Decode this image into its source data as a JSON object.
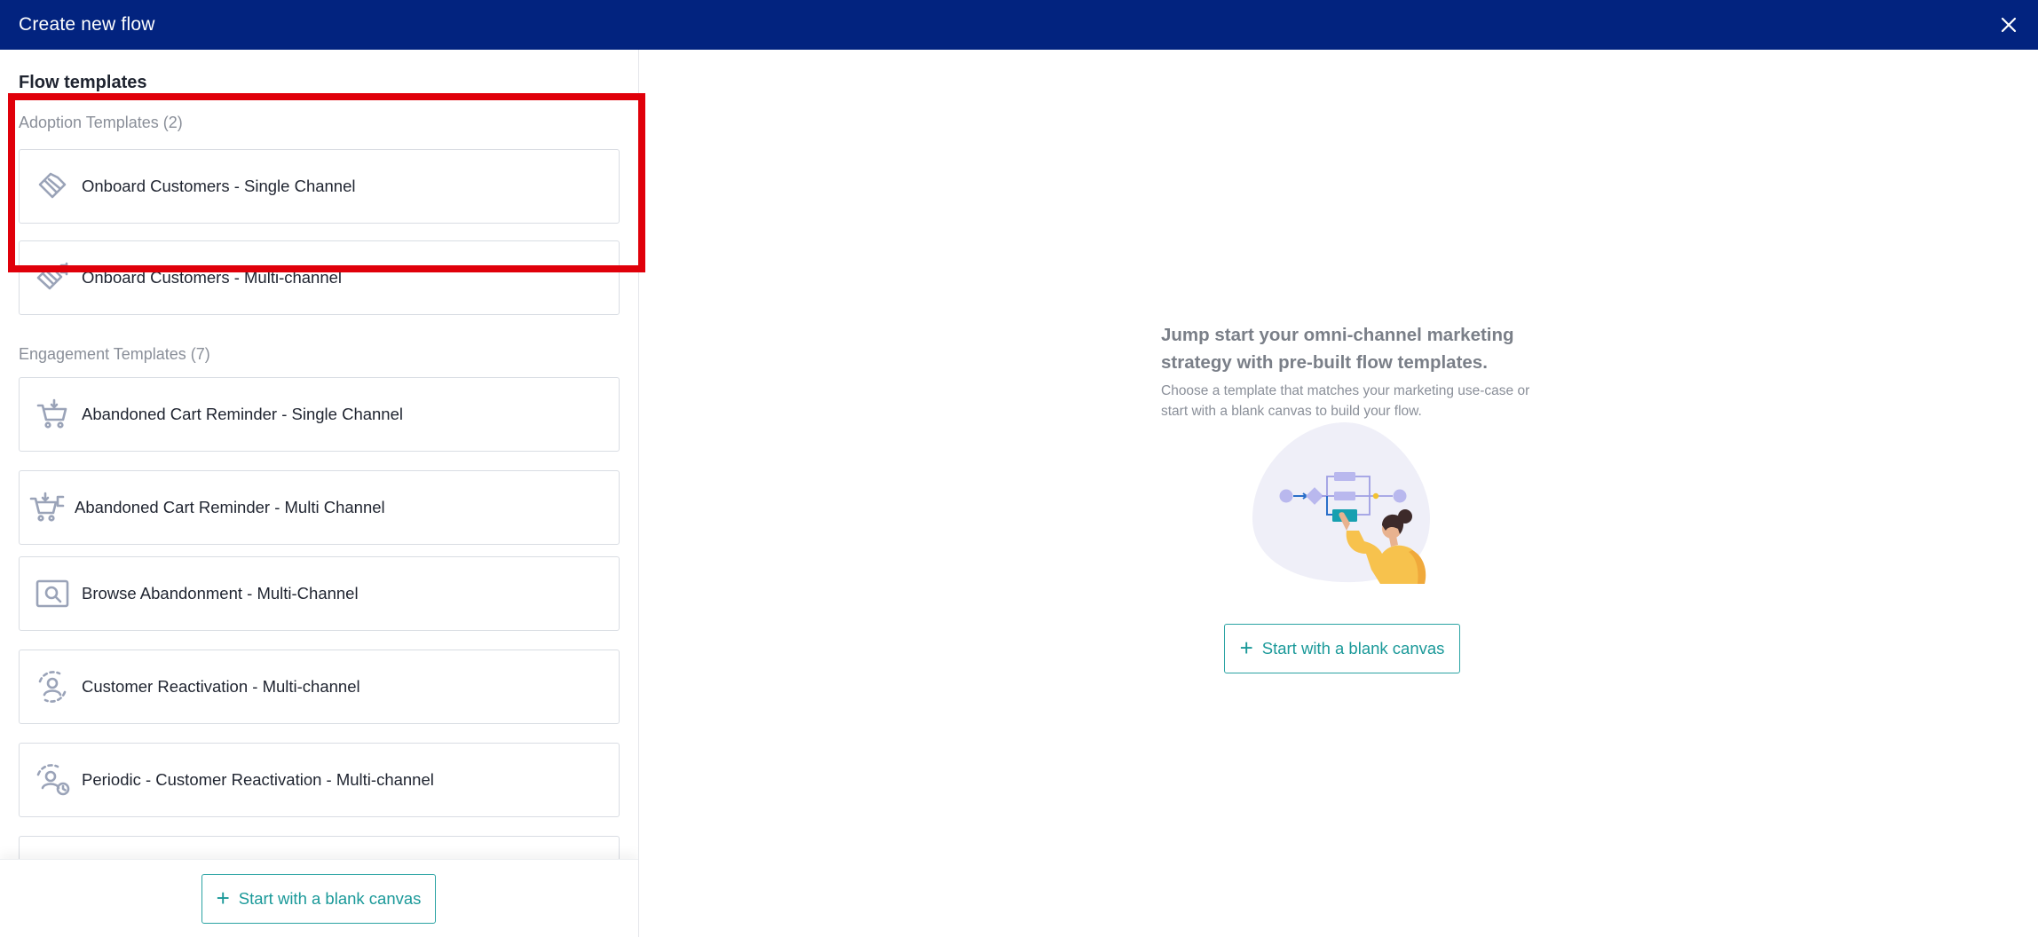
{
  "header": {
    "title": "Create new flow",
    "close_icon": "close-icon"
  },
  "left_panel": {
    "title": "Flow templates",
    "adoption_section": {
      "title": "Adoption Templates (2)",
      "items": [
        {
          "label": "Onboard Customers - Single Channel",
          "icon": "handshake-icon"
        },
        {
          "label": "Onboard Customers - Multi-channel",
          "icon": "handshake-multichannel-icon"
        }
      ]
    },
    "engagement_section": {
      "title": "Engagement Templates (7)",
      "items": [
        {
          "label": "Abandoned Cart Reminder - Single Channel",
          "icon": "cart-icon"
        },
        {
          "label": "Abandoned Cart Reminder - Multi Channel",
          "icon": "cart-multichannel-icon"
        },
        {
          "label": "Browse Abandonment - Multi-Channel",
          "icon": "browse-search-icon"
        },
        {
          "label": "Customer Reactivation - Multi-channel",
          "icon": "user-reactivation-icon"
        },
        {
          "label": "Periodic - Customer Reactivation - Multi-channel",
          "icon": "user-reactivation-clock-icon"
        }
      ]
    },
    "footer": {
      "blank_canvas_label": "Start with a blank canvas"
    }
  },
  "right_panel": {
    "heading": "Jump start your omni-channel marketing strategy with pre-built flow templates.",
    "subtext": "Choose a template that matches your marketing use-case or start with a blank canvas to build your flow.",
    "blank_canvas_label": "Start with a blank canvas",
    "illustration": "flow-builder-illustration"
  },
  "colors": {
    "header_bg": "#02237f",
    "accent_teal": "#1a9999",
    "icon_gray": "#9aa3b8",
    "highlight_red": "#e0000a"
  }
}
